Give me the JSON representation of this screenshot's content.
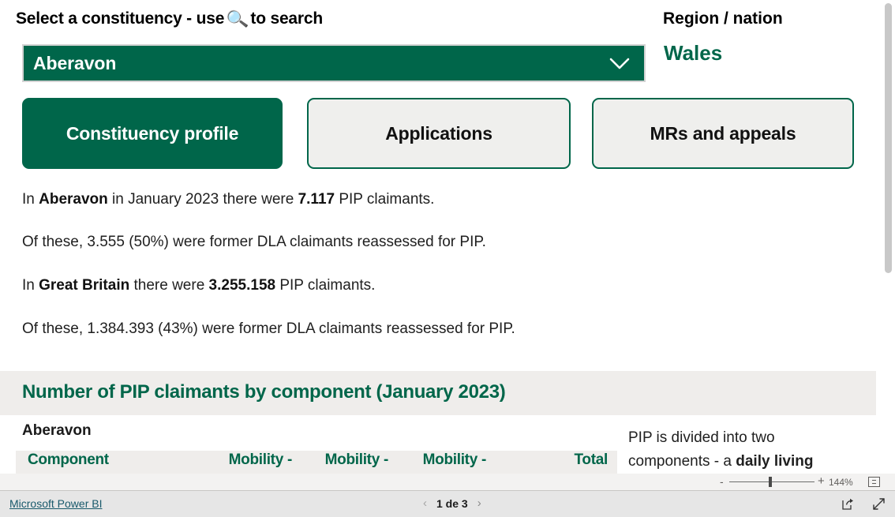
{
  "selector": {
    "label_before": "Select a constituency - use",
    "magnifier_icon": "magnifying-glass-icon",
    "label_after": "to search",
    "selected_value": "Aberavon",
    "chevron_icon": "chevron-down-icon"
  },
  "region": {
    "label": "Region / nation",
    "value": "Wales"
  },
  "nav": {
    "tabs": [
      {
        "label": "Constituency profile",
        "active": true
      },
      {
        "label": "Applications",
        "active": false
      },
      {
        "label": "MRs and appeals",
        "active": false
      }
    ]
  },
  "narrative": {
    "p1": {
      "lead": "In ",
      "bold1": "Aberavon",
      "mid": " in January 2023 there were ",
      "bold2": "7.117",
      "tail": " PIP claimants."
    },
    "p2": {
      "text": "Of these, 3.555 (50%) were former DLA claimants reassessed for PIP."
    },
    "p3": {
      "lead": "In ",
      "bold1": "Great Britain",
      "mid": " there were ",
      "bold2": "3.255.158",
      "tail": " PIP claimants."
    },
    "p4": {
      "text": "Of these, 1.384.393 (43%) were former DLA claimants reassessed for PIP."
    }
  },
  "visual": {
    "title": "Number of PIP claimants by component (January 2023)",
    "table": {
      "caption": "Aberavon",
      "columns": [
        "Component",
        "Mobility -",
        "Mobility -",
        "Mobility -",
        "Total"
      ]
    }
  },
  "side_info": {
    "line1": "PIP is divided into two",
    "line2_lead": "components - a ",
    "line2_bold": "daily living"
  },
  "zoombar": {
    "minus_label": "-",
    "plus_label": "+",
    "percent": "144%",
    "fit_icon": "fit-to-page-icon"
  },
  "footer": {
    "brand": "Microsoft Power BI",
    "prev_icon": "chevron-left-icon",
    "page_text": "1 de 3",
    "next_icon": "chevron-right-icon",
    "share_icon": "share-icon",
    "fullscreen_icon": "fullscreen-icon"
  },
  "colors": {
    "brand_green": "#00664a",
    "band_grey": "#efedeb",
    "footer_grey": "#e6e6e6",
    "link_teal": "#18596b"
  }
}
